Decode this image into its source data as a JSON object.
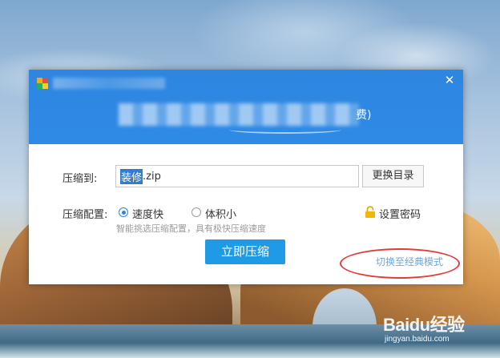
{
  "dialog": {
    "close_glyph": "✕",
    "banner_tail": "费)",
    "path_label": "压缩到:",
    "path_selected": "装修",
    "path_rest": ".zip",
    "change_dir_label": "更换目录",
    "config_label": "压缩配置:",
    "options": [
      {
        "label": "速度快",
        "selected": true
      },
      {
        "label": "体积小",
        "selected": false
      }
    ],
    "hint": "智能挑选压缩配置，具有极快压缩速度",
    "password_label": "设置密码",
    "compress_button": "立即压缩",
    "classic_mode_link": "切换至经典模式"
  },
  "watermark": {
    "brand": "Baidu经验",
    "url": "jingyan.baidu.com"
  },
  "colors": {
    "titlebar": "#2e86e0",
    "primary_button": "#1f9be6",
    "link": "#6aa7e3",
    "annotation_circle": "#e23b3b"
  },
  "icons": [
    "app-logo-icon",
    "close-icon",
    "lock-icon",
    "radio-icon"
  ]
}
